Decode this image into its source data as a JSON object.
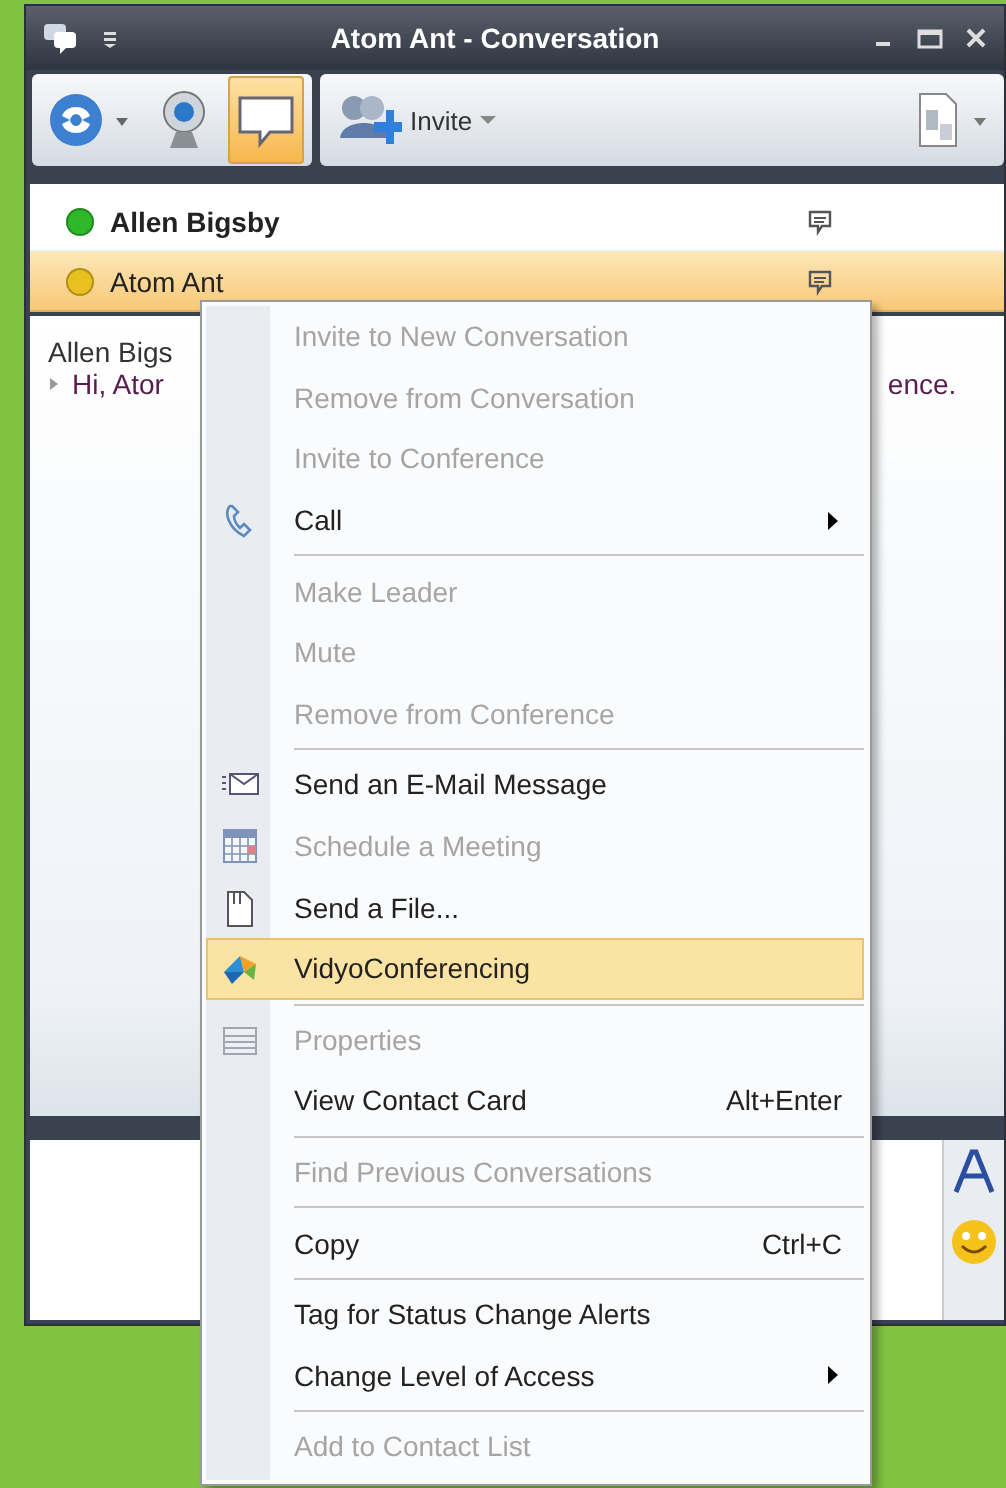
{
  "window": {
    "title": "Atom Ant - Conversation"
  },
  "toolbar": {
    "video_selected": false,
    "im_selected": true,
    "invite_label": "Invite"
  },
  "participants": [
    {
      "name": "Allen Bigsby",
      "color": "#2fb82a",
      "selected": false,
      "bold": true
    },
    {
      "name": "Atom Ant",
      "color": "#e8c020",
      "selected": true,
      "bold": false
    }
  ],
  "conversation": {
    "sender": "Allen Bigs",
    "message_start": "Hi, Ator",
    "message_end": "ence."
  },
  "context_menu": [
    {
      "kind": "plain",
      "label": "Invite to New Conversation",
      "disabled": true
    },
    {
      "kind": "plain",
      "label": "Remove from Conversation",
      "disabled": true
    },
    {
      "kind": "plain",
      "label": "Invite to Conference",
      "disabled": true
    },
    {
      "kind": "call",
      "label": "Call",
      "disabled": false,
      "submenu": true
    },
    {
      "kind": "separator"
    },
    {
      "kind": "plain",
      "label": "Make Leader",
      "disabled": true
    },
    {
      "kind": "plain",
      "label": "Mute",
      "disabled": true
    },
    {
      "kind": "plain",
      "label": "Remove from Conference",
      "disabled": true
    },
    {
      "kind": "separator"
    },
    {
      "kind": "mail",
      "label": "Send an E-Mail Message",
      "disabled": false
    },
    {
      "kind": "calendar",
      "label": "Schedule a Meeting",
      "disabled": true
    },
    {
      "kind": "file",
      "label": "Send a File...",
      "disabled": false
    },
    {
      "kind": "vidyo",
      "label": "VidyoConferencing",
      "disabled": false,
      "selected": true
    },
    {
      "kind": "separator"
    },
    {
      "kind": "properties",
      "label": "Properties",
      "disabled": true
    },
    {
      "kind": "plain",
      "label": "View Contact Card",
      "disabled": false,
      "shortcut": "Alt+Enter"
    },
    {
      "kind": "separator"
    },
    {
      "kind": "plain",
      "label": "Find Previous Conversations",
      "disabled": true
    },
    {
      "kind": "separator"
    },
    {
      "kind": "plain",
      "label": "Copy",
      "disabled": false,
      "shortcut": "Ctrl+C"
    },
    {
      "kind": "separator"
    },
    {
      "kind": "plain",
      "label": "Tag for Status Change Alerts",
      "disabled": false
    },
    {
      "kind": "plain",
      "label": "Change Level of Access",
      "disabled": false,
      "submenu": true
    },
    {
      "kind": "separator"
    },
    {
      "kind": "plain",
      "label": "Add to Contact List",
      "disabled": true
    }
  ]
}
